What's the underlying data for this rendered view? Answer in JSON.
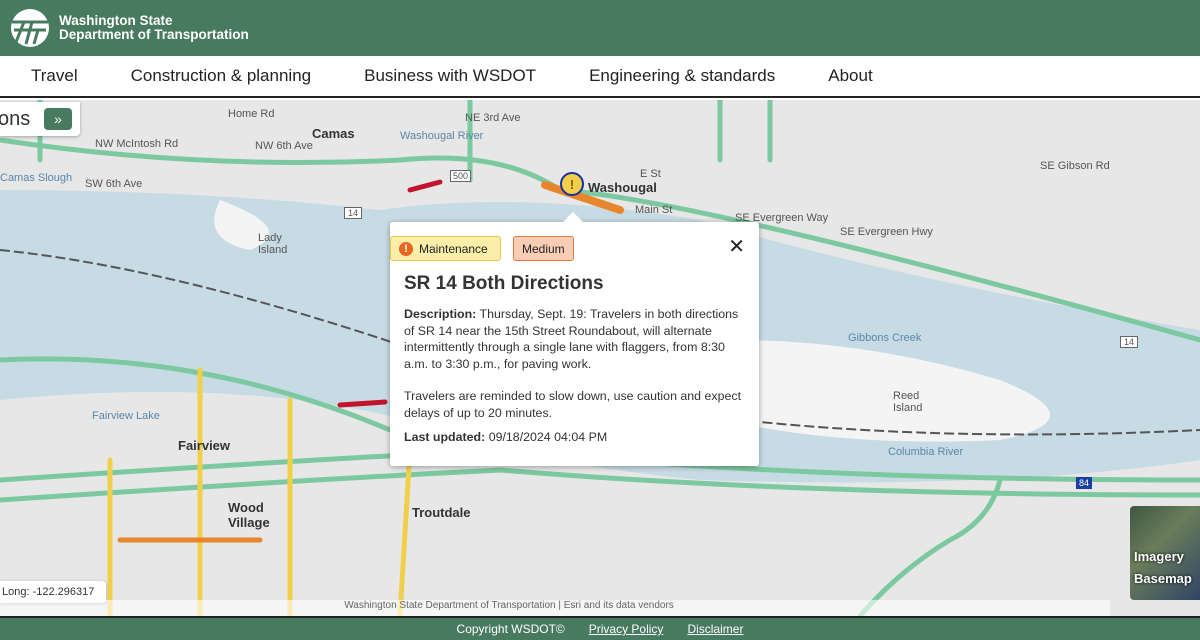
{
  "header": {
    "title_line1": "Washington State",
    "title_line2": "Department of Transportation"
  },
  "nav": [
    "Travel",
    "Construction & planning",
    "Business with WSDOT",
    "Engineering & standards",
    "About"
  ],
  "panel": {
    "label": "ons",
    "expand_icon": "»"
  },
  "map": {
    "towns": [
      "Camas",
      "Washougal",
      "Fairview",
      "Wood Village",
      "Troutdale"
    ],
    "labels": [
      "NE 3rd Ave",
      "Home Rd",
      "NW 6th Ave",
      "NW McIntosh Rd",
      "Washougal River",
      "E St",
      "Main St",
      "SE Evergreen Way",
      "SE Evergreen Hwy",
      "Lady Island",
      "Reed Island",
      "Gibbons Creek",
      "Columbia River",
      "SE Gibson Rd",
      "Fairview Lake",
      "Camas Slough",
      "SW 6th Ave"
    ],
    "shields": [
      "500",
      "14",
      "14",
      "84"
    ],
    "colors": {
      "water": "#c7dbe5",
      "road_good": "#7cc8a0",
      "road_slow": "#f0d04a",
      "road_heavy": "#e8862b",
      "road_stop": "#c4142b"
    }
  },
  "popup": {
    "category": "Maintenance",
    "severity": "Medium",
    "title": "SR 14 Both Directions",
    "description_label": "Description:",
    "description": "Thursday, Sept. 19: Travelers in both directions of SR 14 near the 15th Street Roundabout, will alternate intermittently through a single lane with flaggers, from 8:30 a.m. to 3:30 p.m., for paving work.",
    "note": "Travelers are reminded to slow down, use caution and expect delays of up to 20 minutes.",
    "updated_label": "Last updated:",
    "updated": "09/18/2024 04:04 PM",
    "close": "✕"
  },
  "coords": "Long: -122.296317",
  "attribution": "Washington State Department of Transportation | Esri and its data vendors",
  "basemap": {
    "line1": "Imagery",
    "line2": "Basemap"
  },
  "footer": {
    "copyright": "Copyright WSDOT©",
    "privacy": "Privacy Policy",
    "disclaimer": "Disclaimer"
  }
}
